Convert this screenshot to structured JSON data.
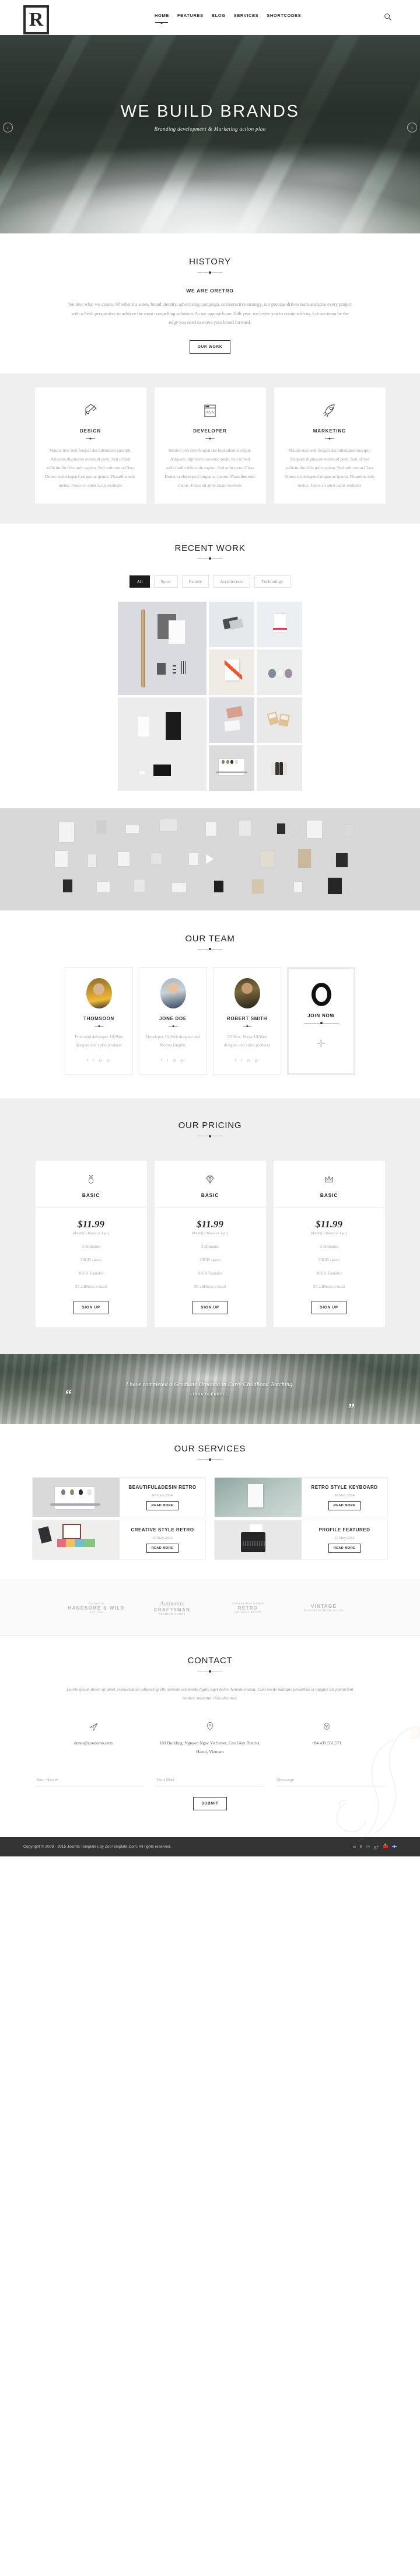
{
  "header": {
    "logo_letter": "R",
    "nav": [
      {
        "label": "HOME",
        "active": true
      },
      {
        "label": "FEATURES",
        "active": false
      },
      {
        "label": "BLOG",
        "active": false
      },
      {
        "label": "SERVICES",
        "active": false
      },
      {
        "label": "SHORTCODES",
        "active": false
      }
    ],
    "search_icon": "search-icon"
  },
  "hero": {
    "title": "WE BUILD BRANDS",
    "subtitle": "Branding development & Marketing action plan",
    "prev_arrow": "‹",
    "next_arrow": "›"
  },
  "history": {
    "title": "HISTORY",
    "subtitle": "WE ARE ORETRO",
    "body": "We love what we create. Whether it's a new brand identity, advertising campaign, or interactive strategy, our process-driven team analyzes every project with a fresh perspective to achieve the most compelling solutions.As we approach our 30th year, we invite you to create with us. Let our team be the edge you need to move your brand forward.",
    "button": "OUR WORK"
  },
  "features": [
    {
      "icon": "pen-nib-icon",
      "name": "DESIGN",
      "text": "Mauris non sem feugiat dui bibendum suscipit. Aliquam dignissim euismod pede. Sed id Sed sollicitudin felis noln sapien. Sed noln tortor.Class Donec scelerisque.Congue ac ipsum. Phasellus nelc metus. Fusce sit amet lacus molestie"
    },
    {
      "icon": "code-window-icon",
      "name": "DEVELOPER",
      "text": "Mauris non sem feugiat dui bibendum suscipit. Aliquam dignissim euismod pede. Sed id Sed sollicitudin felis noln sapien. Sed noln tortor.Class Donec scelerisque.Congue ac ipsum. Phasellus nelc metus. Fusce sit amet lacus molestie"
    },
    {
      "icon": "rocket-icon",
      "name": "MARKETING",
      "text": "Mauris non sem feugiat dui bibendum suscipit. Aliquam dignissim euismod pede. Sed id Sed sollicitudin felis noln sapien. Sed noln tortor.Class Donec scelerisque.Congue ac ipsum. Phasellus nelc metus. Fusce sit amet lacus molestie"
    }
  ],
  "recent_work": {
    "title": "RECENT WORK",
    "filters": [
      {
        "label": "All",
        "active": true
      },
      {
        "label": "Sport",
        "active": false
      },
      {
        "label": "Family",
        "active": false
      },
      {
        "label": "Architecture",
        "active": false
      },
      {
        "label": "Technology",
        "active": false
      }
    ]
  },
  "video": {
    "play_icon": "play-icon"
  },
  "team": {
    "title": "OUR TEAM",
    "members": [
      {
        "name": "THOMSOON",
        "role": "Front-end developer, UI/Web designer and video producer"
      },
      {
        "name": "JONE DOE",
        "role": "Developer, UI/Web designer and Motion Graphic"
      },
      {
        "name": "ROBERT SMITH",
        "role": "3D Max, Maya, UI/Web designer and video producer"
      }
    ],
    "socials": [
      "f",
      "t",
      "in",
      "g+"
    ],
    "join": {
      "label": "JOIN NOW",
      "plus": "✛"
    }
  },
  "pricing": {
    "title": "OUR PRICING",
    "plans": [
      {
        "icon": "ring-icon",
        "name": "BASIC",
        "amount": "$11.99",
        "note": "Monthly ( Based on 1 yr )",
        "features": [
          "2 domains",
          "20GB space",
          "10TB Transfer",
          "25 adDress e-mail"
        ],
        "button": "SIGN UP"
      },
      {
        "icon": "diamond-icon",
        "name": "BASIC",
        "amount": "$11.99",
        "note": "Monthly ( Based on 1 yr )",
        "features": [
          "2 domains",
          "20GB space",
          "10TB Transfer",
          "25 adDress e-mail"
        ],
        "button": "SIGN UP"
      },
      {
        "icon": "crown-icon",
        "name": "BASIC",
        "amount": "$11.99",
        "note": "Monthly ( Based on 1 yr )",
        "features": [
          "2 domains",
          "20GB space",
          "10TB Transfer",
          "25 adDress e-mail"
        ],
        "button": "SIGN UP"
      }
    ]
  },
  "testimonial": {
    "quote": "I have completed a Graduate Diploma in Early Childhood Teaching.",
    "author": "LINDA GLENDELL,",
    "quote_open": "“",
    "quote_close": "”"
  },
  "services": {
    "title": "OUR SERVICES",
    "items": [
      {
        "title": "BEAUTIFUL&DESIN RETRO",
        "date": "09 June 2014",
        "button": "READ MORE",
        "image": "laptop-bulbs-image"
      },
      {
        "title": "RETRO STYLE KEYBOARD",
        "date": "30 May 2014",
        "button": "READ MORE",
        "image": "a4-flyer-mockup-image"
      },
      {
        "title": "CREATIVE STYLE RETRO",
        "date": "30 May 2014",
        "button": "READ MORE",
        "image": "creative-desk-image"
      },
      {
        "title": "PROFILE FEATURED",
        "date": "11 May 2014",
        "button": "READ MORE",
        "image": "typewriter-image"
      }
    ]
  },
  "brands": [
    {
      "line1": "Top Quality",
      "line2": "HANDSOME & WILD",
      "line3": "EST 1954"
    },
    {
      "script": "Authentic",
      "line2": "CRAFTSMAN",
      "line3": "PREMIUM GOODS"
    },
    {
      "line1": "Gourmet Slow Cooked",
      "line2": "RETRO",
      "line3": "ORIGINAL RECIPE"
    },
    {
      "line1": "",
      "line2": "VINTAGE",
      "line3": "HANDMADE MADE GOODS"
    }
  ],
  "contact": {
    "title": "CONTACT",
    "intro": "Lorem ipsum dolor sit amet, consectetuer adipiscing elit, aenean commodo ligula eget dolor. Aenean massa. Cum sociis natoque penatibus et magnis dis parturient montes, nascetur ridiculus mus.",
    "info": [
      {
        "icon": "paper-plane-icon",
        "text": "demo@zoodemo.com"
      },
      {
        "icon": "location-pin-icon",
        "text": "169 Building, Nguyen Ngoc Vu Street, Cau Giay District, Hanoi, Vietnam"
      },
      {
        "icon": "phone-icon",
        "text": "+84 435.551.571"
      }
    ],
    "form": {
      "name_placeholder": "Your Name",
      "mail_placeholder": "Yout Mail",
      "message_placeholder": "Message",
      "submit": "SUBMIT"
    }
  },
  "footer": {
    "copyright": "Copyright © 2008 - 2015 Joomla Templates by ZooTemplate.Com. All rights reserved.",
    "socials": [
      "twitter-icon",
      "facebook-icon",
      "pinterest-icon",
      "google-plus-icon"
    ],
    "flags": [
      "vietnam-flag-icon",
      "uk-flag-icon"
    ]
  }
}
